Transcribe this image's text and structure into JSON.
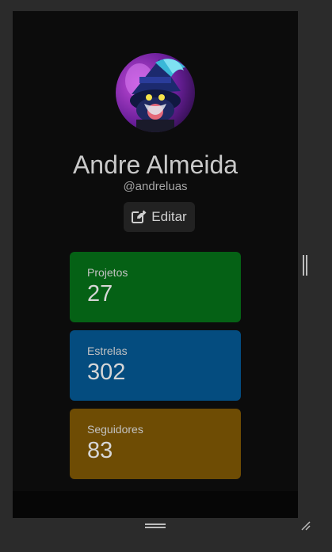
{
  "profile": {
    "name": "Andre Almeida",
    "handle": "@andreluas",
    "edit_label": "Editar",
    "edit_icon": "pencil-square-icon",
    "avatar": "avatar-image"
  },
  "stats": [
    {
      "label": "Projetos",
      "value": "27",
      "color": "#056115"
    },
    {
      "label": "Estrelas",
      "value": "302",
      "color": "#044c7f"
    },
    {
      "label": "Seguidores",
      "value": "83",
      "color": "#6e4c04"
    }
  ],
  "colors": {
    "background": "#0c0c0c",
    "outer": "#2b2b2b",
    "button": "#222222"
  }
}
